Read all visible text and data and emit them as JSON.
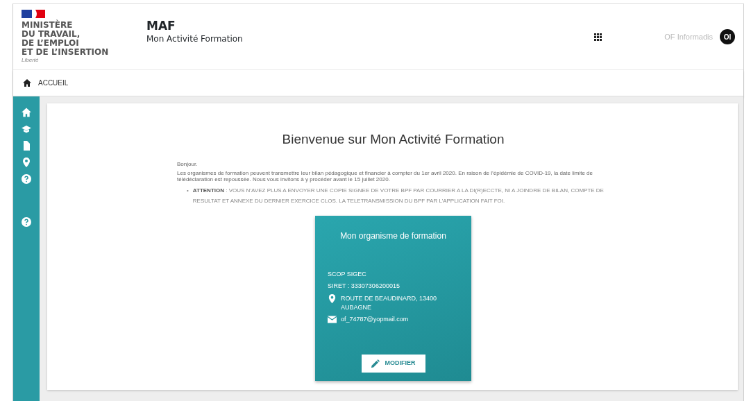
{
  "header": {
    "ministry": [
      "MINISTÈRE",
      "DU TRAVAIL,",
      "DE L’EMPLOI",
      "ET DE L’INSERTION"
    ],
    "motto": "Liberté",
    "app_name": "MAF",
    "app_subtitle": "Mon Activité Formation",
    "user_name": "OF Informadis",
    "avatar_initials": "OI"
  },
  "breadcrumb": {
    "label": "ACCUEIL"
  },
  "main": {
    "title": "Bienvenue sur Mon Activité Formation",
    "greeting": "Bonjour.",
    "intro": "Les organismes de formation peuvent transmettre leur bilan pédagogique et financier à compter du 1er avril 2020. En raison de l’épidémie de COVID-19, la date limite de télédéclaration est repoussée. Nous vous invitons à y procéder avant le 15 juillet 2020.",
    "notice_bullet": "•",
    "notices": [
      "**ATTENTION** : VOUS N’AVEZ PLUS A ENVOYER UNE COPIE SIGNEE DE VOTRE BPF PAR COURRIER A LA DI(R)ECCTE, NI A JOINDRE DE BILAN, COMPTE DE RESULTAT ET ANNEXE DU DERNIER EXERCICE CLOS. LA TELETRANSMISSION DU BPF PAR L’APPLICATION FAIT FOI."
    ]
  },
  "organisation_card": {
    "title": "Mon organisme de formation",
    "name": "SCOP SIGEC",
    "siret": "SIRET : 33307306200015",
    "address": "ROUTE DE BEAUDINARD, 13400 AUBAGNE",
    "email": "of_74787@yopmail.com",
    "button": "MODIFIER"
  }
}
